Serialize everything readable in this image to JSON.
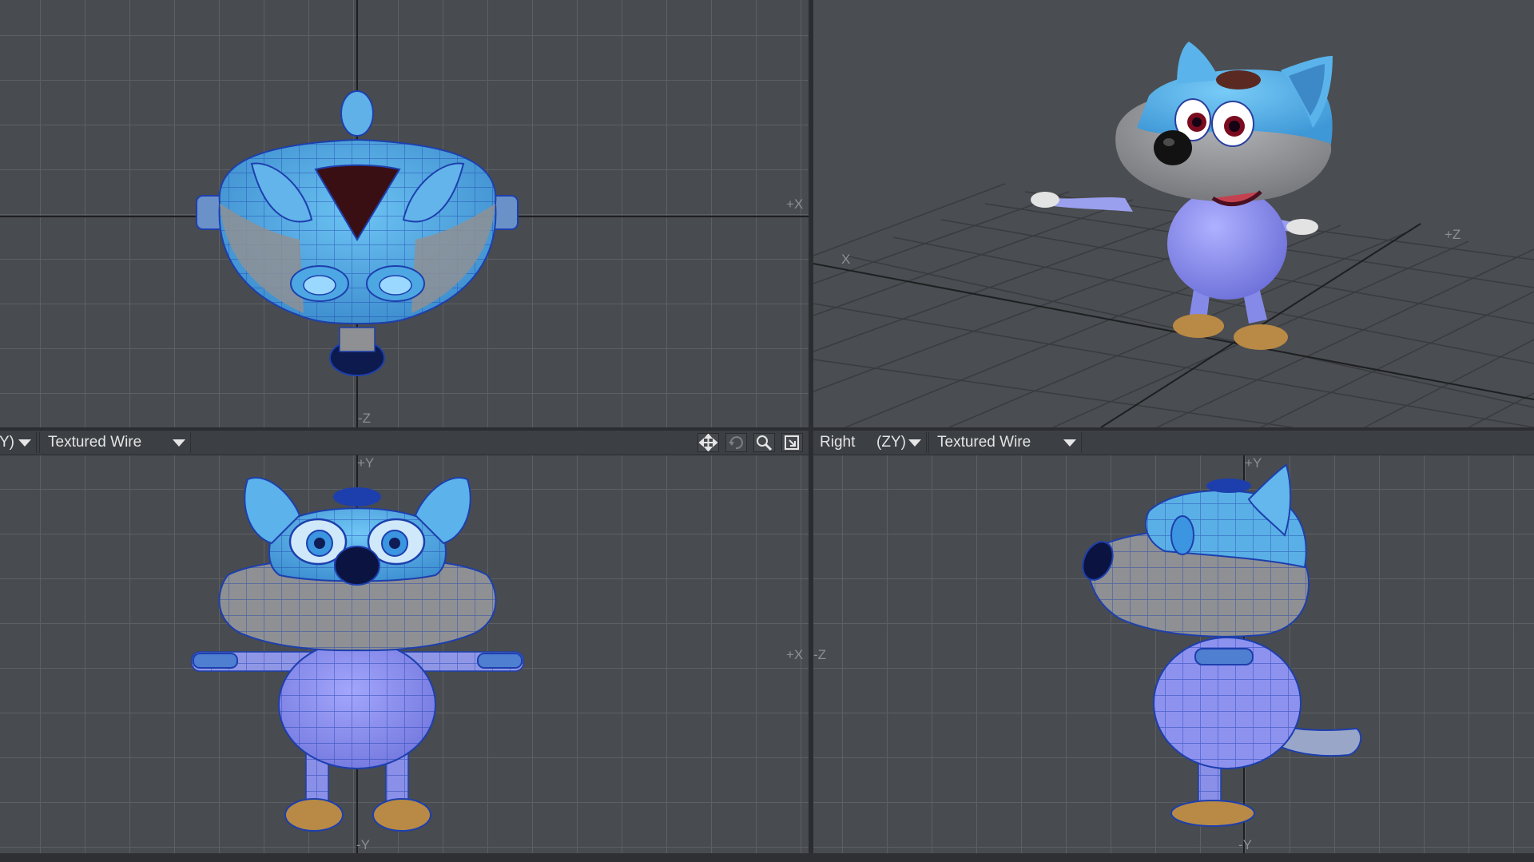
{
  "viewports": {
    "top_left": {
      "label_pos_x": "+X",
      "label_neg_z": "-Z"
    },
    "top_right": {
      "label_x": "X",
      "label_z": "+Z"
    },
    "bottom_left": {
      "view_tail": "Y)",
      "mode": "Textured Wire",
      "label_pos_y": "+Y",
      "label_pos_x": "+X",
      "label_neg_y": "-Y",
      "tools": [
        "move-icon",
        "rotate-icon",
        "zoom-icon",
        "maximize-icon"
      ]
    },
    "bottom_right": {
      "view": "Right",
      "axes": "(ZY)",
      "mode": "Textured Wire",
      "label_pos_y": "+Y",
      "label_neg_z": "-Z",
      "label_neg_y": "-Y"
    }
  },
  "colors": {
    "viewport_bg": "#484b4f",
    "grid_line": "#5c5f63",
    "mesh_wire": "#1d3fae",
    "head_blue": "#5ab0e6",
    "body_purple": "#8f92f0",
    "fur_gray": "#8e9094",
    "feet_brown": "#b88a45"
  }
}
